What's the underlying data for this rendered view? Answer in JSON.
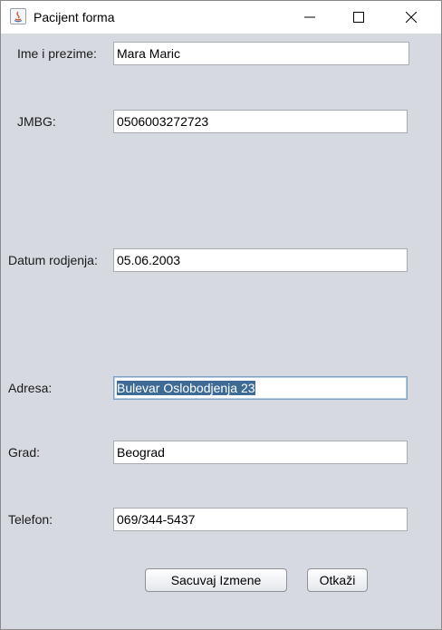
{
  "window": {
    "title": "Pacijent forma"
  },
  "form": {
    "ime_label": "Ime i prezime:",
    "ime_value": "Mara Maric",
    "jmbg_label": "JMBG:",
    "jmbg_value": "0506003272723",
    "datum_label": "Datum rodjenja:",
    "datum_value": "05.06.2003",
    "adresa_label": "Adresa:",
    "adresa_value": "Bulevar Oslobodjenja 23",
    "grad_label": "Grad:",
    "grad_value": "Beograd",
    "telefon_label": "Telefon:",
    "telefon_value": "069/344-5437"
  },
  "buttons": {
    "save_label": "Sacuvaj Izmene",
    "cancel_label": "Otkaži"
  }
}
